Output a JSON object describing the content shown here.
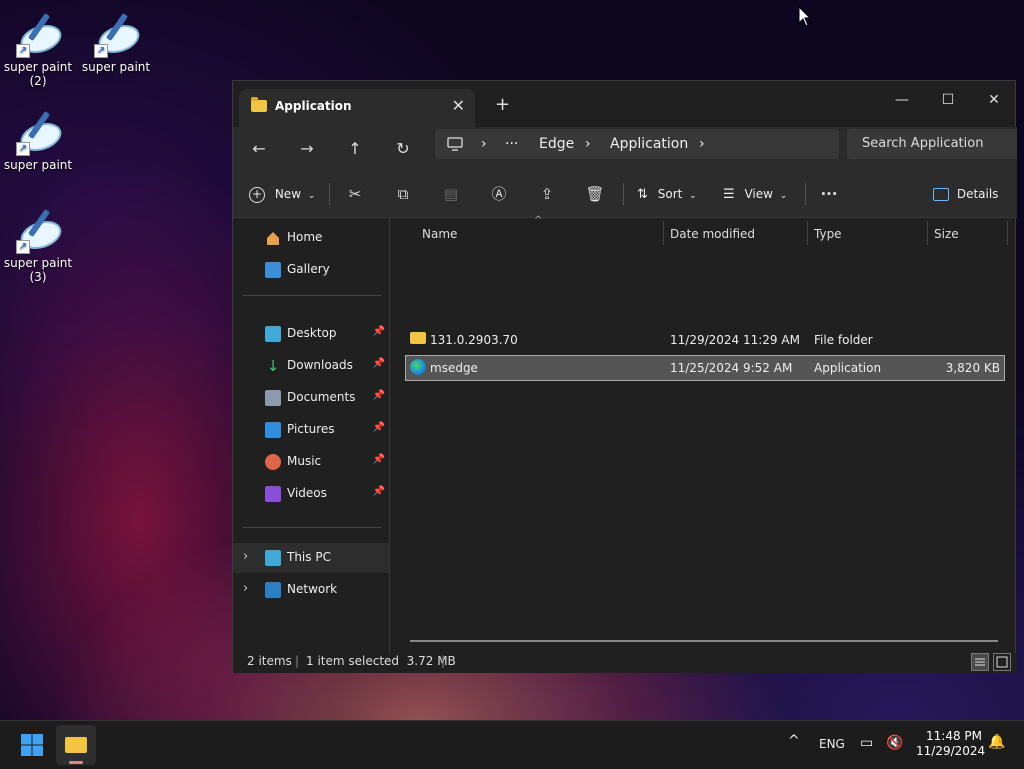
{
  "desktop": {
    "icons": [
      {
        "label": "super paint\n(2)"
      },
      {
        "label": "super paint"
      },
      {
        "label": "super paint"
      },
      {
        "label": "super paint\n(3)"
      }
    ]
  },
  "window": {
    "tab_title": "Application",
    "close_tab_glyph": "✕",
    "new_tab_glyph": "+",
    "minimize_glyph": "—",
    "maximize_glyph": "☐",
    "close_glyph": "✕"
  },
  "nav": {
    "breadcrumb": [
      "Edge",
      "Application"
    ],
    "more_glyph": "···",
    "search_placeholder": "Search Application"
  },
  "toolbar": {
    "new_label": "New",
    "sort_label": "Sort",
    "view_label": "View",
    "details_label": "Details"
  },
  "sidebar": {
    "items": [
      {
        "label": "Home",
        "icon": "home-icon"
      },
      {
        "label": "Gallery",
        "icon": "gallery-icon"
      },
      {
        "label": "Desktop",
        "icon": "desktop-icon"
      },
      {
        "label": "Downloads",
        "icon": "downloads-icon"
      },
      {
        "label": "Documents",
        "icon": "documents-icon"
      },
      {
        "label": "Pictures",
        "icon": "pictures-icon"
      },
      {
        "label": "Music",
        "icon": "music-icon"
      },
      {
        "label": "Videos",
        "icon": "videos-icon"
      },
      {
        "label": "This PC",
        "icon": "this-pc-icon"
      },
      {
        "label": "Network",
        "icon": "network-icon"
      }
    ]
  },
  "files": {
    "columns": [
      "Name",
      "Date modified",
      "Type",
      "Size"
    ],
    "rows": [
      {
        "name": "131.0.2903.70",
        "date": "11/29/2024 11:29 AM",
        "type": "File folder",
        "size": ""
      },
      {
        "name": "msedge",
        "date": "11/25/2024 9:52 AM",
        "type": "Application",
        "size": "3,820 KB"
      }
    ]
  },
  "status": {
    "count": "2 items",
    "selected": "1 item selected  3.72 MB"
  },
  "taskbar": {
    "lang": "ENG",
    "time": "11:48 PM",
    "date": "11/29/2024"
  },
  "colors": {
    "folder": "#f4c542",
    "accent": "#0078d4"
  }
}
